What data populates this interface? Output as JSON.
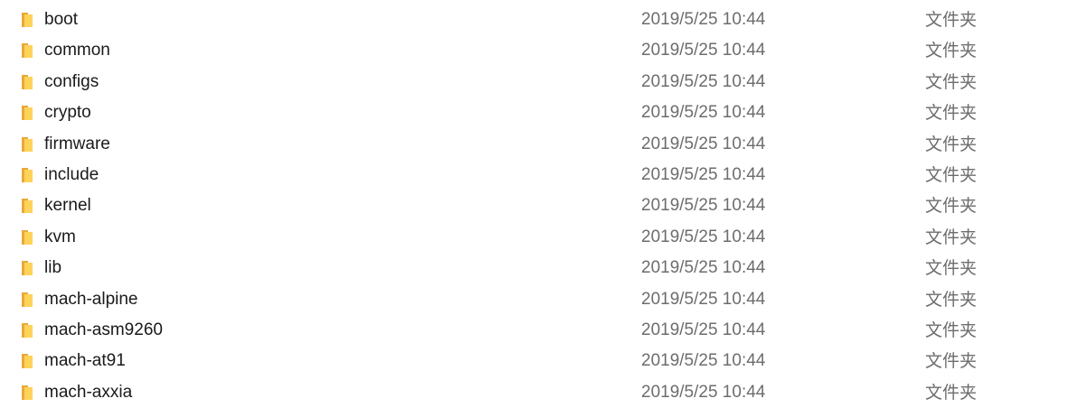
{
  "colors": {
    "folder_front": "#FFD25A",
    "folder_back": "#E8A93A",
    "name_text": "#1a1a1a",
    "meta_text": "#6d6d6d"
  },
  "files": [
    {
      "name": "boot",
      "date": "2019/5/25 10:44",
      "type": "文件夹",
      "icon": "folder-icon"
    },
    {
      "name": "common",
      "date": "2019/5/25 10:44",
      "type": "文件夹",
      "icon": "folder-icon"
    },
    {
      "name": "configs",
      "date": "2019/5/25 10:44",
      "type": "文件夹",
      "icon": "folder-icon"
    },
    {
      "name": "crypto",
      "date": "2019/5/25 10:44",
      "type": "文件夹",
      "icon": "folder-icon"
    },
    {
      "name": "firmware",
      "date": "2019/5/25 10:44",
      "type": "文件夹",
      "icon": "folder-icon"
    },
    {
      "name": "include",
      "date": "2019/5/25 10:44",
      "type": "文件夹",
      "icon": "folder-icon"
    },
    {
      "name": "kernel",
      "date": "2019/5/25 10:44",
      "type": "文件夹",
      "icon": "folder-icon"
    },
    {
      "name": "kvm",
      "date": "2019/5/25 10:44",
      "type": "文件夹",
      "icon": "folder-icon"
    },
    {
      "name": "lib",
      "date": "2019/5/25 10:44",
      "type": "文件夹",
      "icon": "folder-icon"
    },
    {
      "name": "mach-alpine",
      "date": "2019/5/25 10:44",
      "type": "文件夹",
      "icon": "folder-icon"
    },
    {
      "name": "mach-asm9260",
      "date": "2019/5/25 10:44",
      "type": "文件夹",
      "icon": "folder-icon"
    },
    {
      "name": "mach-at91",
      "date": "2019/5/25 10:44",
      "type": "文件夹",
      "icon": "folder-icon"
    },
    {
      "name": "mach-axxia",
      "date": "2019/5/25 10:44",
      "type": "文件夹",
      "icon": "folder-icon"
    }
  ]
}
